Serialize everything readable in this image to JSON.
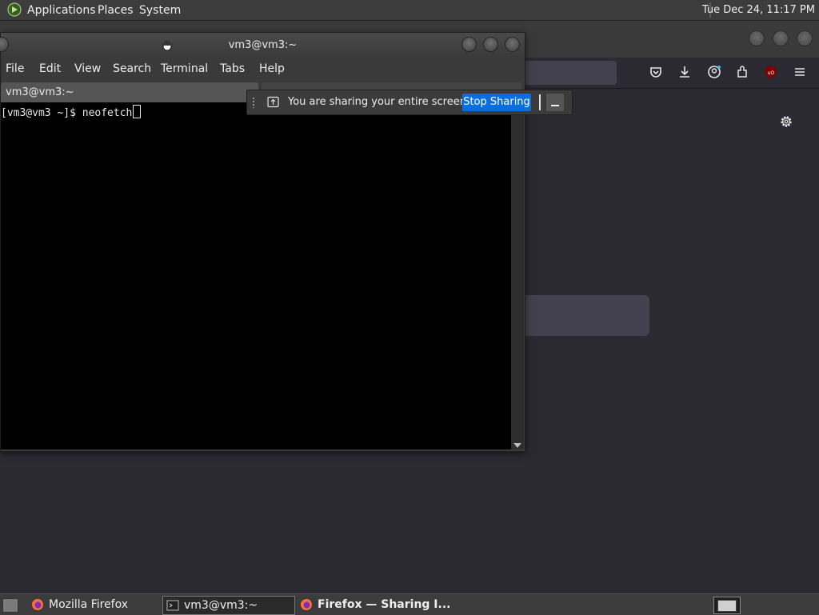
{
  "top_panel": {
    "menus": [
      "Applications",
      "Places",
      "System"
    ],
    "clock": "Tue Dec 24, 11:17 PM"
  },
  "terminal": {
    "title": "vm3@vm3:~",
    "menu": [
      "File",
      "Edit",
      "View",
      "Search",
      "Terminal",
      "Tabs",
      "Help"
    ],
    "tab_label": "vm3@vm3:~",
    "prompt": "[vm3@vm3 ~]$ ",
    "command": "neofetch"
  },
  "share_notification": {
    "message": "You are sharing your entire screen.",
    "stop_label": "Stop Sharing"
  },
  "taskbar": {
    "tasks": [
      {
        "label": "Mozilla Firefox",
        "icon": "firefox-icon"
      },
      {
        "label": "vm3@vm3:~",
        "icon": "terminal-icon"
      },
      {
        "label": "Firefox — Sharing I...",
        "icon": "firefox-icon"
      }
    ]
  },
  "colors": {
    "accent": "#0a6ee0",
    "desktop_bg": "#2b2a33",
    "terminal_bg": "#000000"
  }
}
